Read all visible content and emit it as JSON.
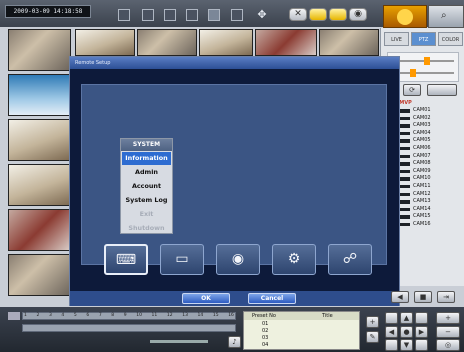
{
  "header": {
    "datetime": "2009-03-09 14:18:58",
    "tool_icons": [
      "fullscreen-icon",
      "grid-4-icon",
      "grid-9-icon",
      "grid-16-icon",
      "sequence-icon",
      "grid-layout-icon",
      "ptz-move-icon",
      "settings-icon",
      "record-icon",
      "snapshot-icon",
      "playback-icon",
      "search-icon"
    ]
  },
  "dialog": {
    "title": "Remote Setup",
    "menu": {
      "header": "SYSTEM",
      "items": [
        {
          "label": "Information",
          "state": "selected"
        },
        {
          "label": "Admin",
          "state": "normal"
        },
        {
          "label": "Account",
          "state": "normal"
        },
        {
          "label": "System Log",
          "state": "normal"
        },
        {
          "label": "Exit",
          "state": "disabled"
        },
        {
          "label": "Shutdown",
          "state": "disabled"
        }
      ]
    },
    "categories": [
      {
        "name": "system-icon",
        "selected": true
      },
      {
        "name": "display-icon",
        "selected": false
      },
      {
        "name": "camera-icon",
        "selected": false
      },
      {
        "name": "record-settings-icon",
        "selected": false
      },
      {
        "name": "network-icon",
        "selected": false
      }
    ],
    "ok_label": "OK",
    "cancel_label": "Cancel"
  },
  "right_panel": {
    "tabs": [
      "LIVE",
      "PTZ",
      "COLOR"
    ],
    "active_tab": "PTZ",
    "tree_root": "OMVP",
    "cameras": [
      "CAM01",
      "CAM02",
      "CAM03",
      "CAM04",
      "CAM05",
      "CAM06",
      "CAM07",
      "CAM08",
      "CAM09",
      "CAM10",
      "CAM11",
      "CAM12",
      "CAM13",
      "CAM14",
      "CAM15",
      "CAM16"
    ]
  },
  "bottom": {
    "timeline_numbers": [
      "1",
      "2",
      "3",
      "4",
      "5",
      "6",
      "7",
      "8",
      "9",
      "10",
      "11",
      "12",
      "13",
      "14",
      "15",
      "16"
    ],
    "preset_header": [
      "Preset No",
      "Title"
    ],
    "presets": [
      "01",
      "02",
      "03",
      "04"
    ]
  },
  "colors": {
    "accent": "#2d6cd1",
    "dialog_bg": "#0d1a3a",
    "panel_bg": "#3b5584"
  }
}
